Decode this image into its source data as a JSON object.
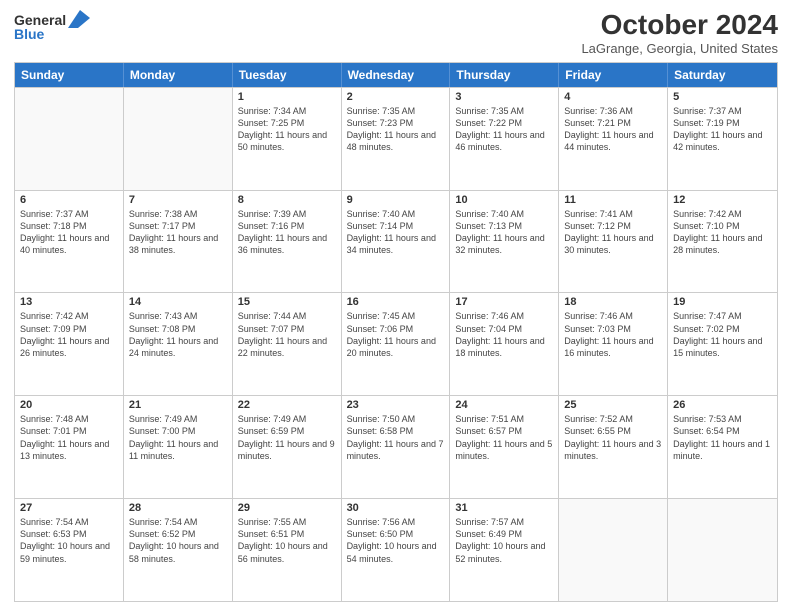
{
  "logo": {
    "line1": "General",
    "line2": "Blue",
    "arrow_color": "#2a75c7"
  },
  "header": {
    "month": "October 2024",
    "location": "LaGrange, Georgia, United States"
  },
  "days_of_week": [
    "Sunday",
    "Monday",
    "Tuesday",
    "Wednesday",
    "Thursday",
    "Friday",
    "Saturday"
  ],
  "weeks": [
    [
      {
        "day": "",
        "empty": true
      },
      {
        "day": "",
        "empty": true
      },
      {
        "day": "1",
        "sunrise": "Sunrise: 7:34 AM",
        "sunset": "Sunset: 7:25 PM",
        "daylight": "Daylight: 11 hours and 50 minutes."
      },
      {
        "day": "2",
        "sunrise": "Sunrise: 7:35 AM",
        "sunset": "Sunset: 7:23 PM",
        "daylight": "Daylight: 11 hours and 48 minutes."
      },
      {
        "day": "3",
        "sunrise": "Sunrise: 7:35 AM",
        "sunset": "Sunset: 7:22 PM",
        "daylight": "Daylight: 11 hours and 46 minutes."
      },
      {
        "day": "4",
        "sunrise": "Sunrise: 7:36 AM",
        "sunset": "Sunset: 7:21 PM",
        "daylight": "Daylight: 11 hours and 44 minutes."
      },
      {
        "day": "5",
        "sunrise": "Sunrise: 7:37 AM",
        "sunset": "Sunset: 7:19 PM",
        "daylight": "Daylight: 11 hours and 42 minutes."
      }
    ],
    [
      {
        "day": "6",
        "sunrise": "Sunrise: 7:37 AM",
        "sunset": "Sunset: 7:18 PM",
        "daylight": "Daylight: 11 hours and 40 minutes."
      },
      {
        "day": "7",
        "sunrise": "Sunrise: 7:38 AM",
        "sunset": "Sunset: 7:17 PM",
        "daylight": "Daylight: 11 hours and 38 minutes."
      },
      {
        "day": "8",
        "sunrise": "Sunrise: 7:39 AM",
        "sunset": "Sunset: 7:16 PM",
        "daylight": "Daylight: 11 hours and 36 minutes."
      },
      {
        "day": "9",
        "sunrise": "Sunrise: 7:40 AM",
        "sunset": "Sunset: 7:14 PM",
        "daylight": "Daylight: 11 hours and 34 minutes."
      },
      {
        "day": "10",
        "sunrise": "Sunrise: 7:40 AM",
        "sunset": "Sunset: 7:13 PM",
        "daylight": "Daylight: 11 hours and 32 minutes."
      },
      {
        "day": "11",
        "sunrise": "Sunrise: 7:41 AM",
        "sunset": "Sunset: 7:12 PM",
        "daylight": "Daylight: 11 hours and 30 minutes."
      },
      {
        "day": "12",
        "sunrise": "Sunrise: 7:42 AM",
        "sunset": "Sunset: 7:10 PM",
        "daylight": "Daylight: 11 hours and 28 minutes."
      }
    ],
    [
      {
        "day": "13",
        "sunrise": "Sunrise: 7:42 AM",
        "sunset": "Sunset: 7:09 PM",
        "daylight": "Daylight: 11 hours and 26 minutes."
      },
      {
        "day": "14",
        "sunrise": "Sunrise: 7:43 AM",
        "sunset": "Sunset: 7:08 PM",
        "daylight": "Daylight: 11 hours and 24 minutes."
      },
      {
        "day": "15",
        "sunrise": "Sunrise: 7:44 AM",
        "sunset": "Sunset: 7:07 PM",
        "daylight": "Daylight: 11 hours and 22 minutes."
      },
      {
        "day": "16",
        "sunrise": "Sunrise: 7:45 AM",
        "sunset": "Sunset: 7:06 PM",
        "daylight": "Daylight: 11 hours and 20 minutes."
      },
      {
        "day": "17",
        "sunrise": "Sunrise: 7:46 AM",
        "sunset": "Sunset: 7:04 PM",
        "daylight": "Daylight: 11 hours and 18 minutes."
      },
      {
        "day": "18",
        "sunrise": "Sunrise: 7:46 AM",
        "sunset": "Sunset: 7:03 PM",
        "daylight": "Daylight: 11 hours and 16 minutes."
      },
      {
        "day": "19",
        "sunrise": "Sunrise: 7:47 AM",
        "sunset": "Sunset: 7:02 PM",
        "daylight": "Daylight: 11 hours and 15 minutes."
      }
    ],
    [
      {
        "day": "20",
        "sunrise": "Sunrise: 7:48 AM",
        "sunset": "Sunset: 7:01 PM",
        "daylight": "Daylight: 11 hours and 13 minutes."
      },
      {
        "day": "21",
        "sunrise": "Sunrise: 7:49 AM",
        "sunset": "Sunset: 7:00 PM",
        "daylight": "Daylight: 11 hours and 11 minutes."
      },
      {
        "day": "22",
        "sunrise": "Sunrise: 7:49 AM",
        "sunset": "Sunset: 6:59 PM",
        "daylight": "Daylight: 11 hours and 9 minutes."
      },
      {
        "day": "23",
        "sunrise": "Sunrise: 7:50 AM",
        "sunset": "Sunset: 6:58 PM",
        "daylight": "Daylight: 11 hours and 7 minutes."
      },
      {
        "day": "24",
        "sunrise": "Sunrise: 7:51 AM",
        "sunset": "Sunset: 6:57 PM",
        "daylight": "Daylight: 11 hours and 5 minutes."
      },
      {
        "day": "25",
        "sunrise": "Sunrise: 7:52 AM",
        "sunset": "Sunset: 6:55 PM",
        "daylight": "Daylight: 11 hours and 3 minutes."
      },
      {
        "day": "26",
        "sunrise": "Sunrise: 7:53 AM",
        "sunset": "Sunset: 6:54 PM",
        "daylight": "Daylight: 11 hours and 1 minute."
      }
    ],
    [
      {
        "day": "27",
        "sunrise": "Sunrise: 7:54 AM",
        "sunset": "Sunset: 6:53 PM",
        "daylight": "Daylight: 10 hours and 59 minutes."
      },
      {
        "day": "28",
        "sunrise": "Sunrise: 7:54 AM",
        "sunset": "Sunset: 6:52 PM",
        "daylight": "Daylight: 10 hours and 58 minutes."
      },
      {
        "day": "29",
        "sunrise": "Sunrise: 7:55 AM",
        "sunset": "Sunset: 6:51 PM",
        "daylight": "Daylight: 10 hours and 56 minutes."
      },
      {
        "day": "30",
        "sunrise": "Sunrise: 7:56 AM",
        "sunset": "Sunset: 6:50 PM",
        "daylight": "Daylight: 10 hours and 54 minutes."
      },
      {
        "day": "31",
        "sunrise": "Sunrise: 7:57 AM",
        "sunset": "Sunset: 6:49 PM",
        "daylight": "Daylight: 10 hours and 52 minutes."
      },
      {
        "day": "",
        "empty": true
      },
      {
        "day": "",
        "empty": true
      }
    ]
  ]
}
